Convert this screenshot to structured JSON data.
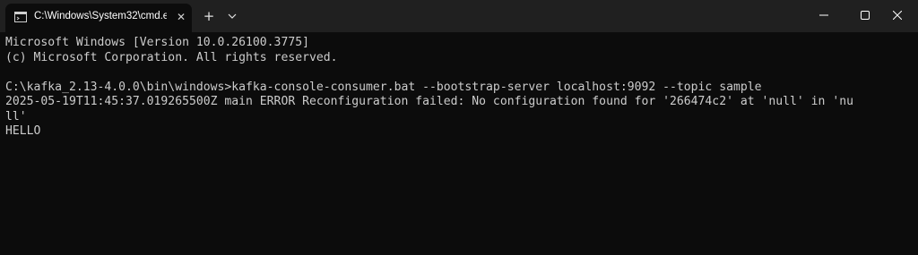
{
  "tab": {
    "title": "C:\\Windows\\System32\\cmd.e",
    "icon": "cmd-icon",
    "close_glyph": "✕",
    "new_tab_glyph": "+"
  },
  "window_controls": {
    "minimize_icon": "minimize-icon",
    "maximize_icon": "maximize-icon",
    "close_icon": "close-icon"
  },
  "console": {
    "lines": [
      "Microsoft Windows [Version 10.0.26100.3775]",
      "(c) Microsoft Corporation. All rights reserved.",
      "",
      "C:\\kafka_2.13-4.0.0\\bin\\windows>kafka-console-consumer.bat --bootstrap-server localhost:9092 --topic sample",
      "2025-05-19T11:45:37.019265500Z main ERROR Reconfiguration failed: No configuration found for '266474c2' at 'null' in 'nu",
      "ll'",
      "HELLO"
    ]
  },
  "colors": {
    "titlebar": "#202020",
    "console_bg": "#0c0c0c",
    "console_text": "#cccccc"
  }
}
